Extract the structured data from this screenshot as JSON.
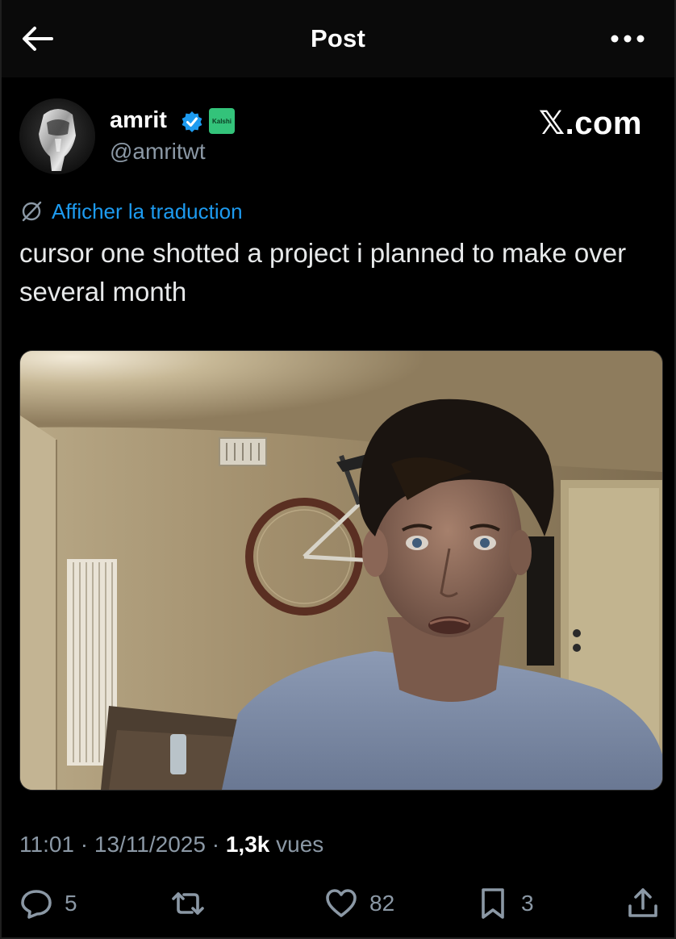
{
  "header": {
    "title": "Post"
  },
  "author": {
    "name": "amrit",
    "handle": "@amritwt",
    "affiliation_badge": "Kalshi",
    "verified": true
  },
  "brand": "𝕏.com",
  "translate_link": "Afficher la traduction",
  "tweet_text": "cursor one shotted a project i planned to make over several month",
  "meta": {
    "time": "11:01",
    "date": "13/11/2025",
    "views_count": "1,3k",
    "views_label": "vues",
    "separator": "·"
  },
  "actions": {
    "replies": "5",
    "reposts": "",
    "likes": "82",
    "bookmarks": "3"
  },
  "colors": {
    "accent": "#1d9bf0",
    "text": "#e7e9ea",
    "secondary": "#8b98a5",
    "background": "#000000"
  },
  "icons": [
    "back-arrow-icon",
    "more-dots-icon",
    "verified-icon",
    "translate-icon",
    "reply-icon",
    "repost-icon",
    "like-icon",
    "bookmark-icon",
    "share-icon"
  ]
}
